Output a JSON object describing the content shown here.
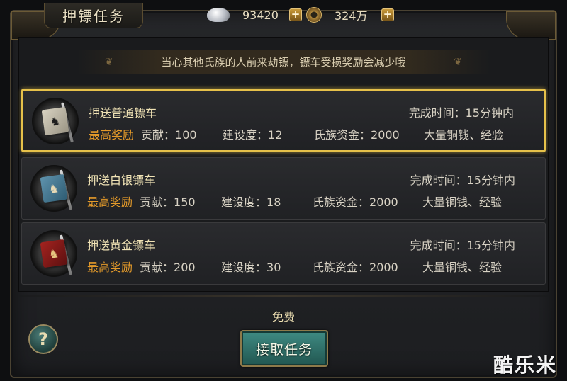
{
  "window": {
    "title": "押镖任务"
  },
  "currency": {
    "silver_value": "93420",
    "silver_icon": "silver-ingot-icon",
    "gold_value": "324万",
    "gold_icon": "copper-coin-icon",
    "add_label": "+"
  },
  "notice": "当心其他氏族的人前来劫镖，镖车受损奖励会减少哦",
  "tasks": [
    {
      "title": "押送普通镖车",
      "time": "完成时间：15分钟内",
      "reward_head": "最高奖励",
      "contribution": "贡献：100",
      "construction": "建设度：12",
      "clan_funds": "氏族资金：2000",
      "extra": "大量铜钱、经验",
      "flag_glyph": "♞",
      "selected": true
    },
    {
      "title": "押送白银镖车",
      "time": "完成时间：15分钟内",
      "reward_head": "最高奖励",
      "contribution": "贡献：150",
      "construction": "建设度：18",
      "clan_funds": "氏族资金：2000",
      "extra": "大量铜钱、经验",
      "flag_glyph": "♞",
      "selected": false
    },
    {
      "title": "押送黄金镖车",
      "time": "完成时间：15分钟内",
      "reward_head": "最高奖励",
      "contribution": "贡献：200",
      "construction": "建设度：30",
      "clan_funds": "氏族资金：2000",
      "extra": "大量铜钱、经验",
      "flag_glyph": "♞",
      "selected": false
    }
  ],
  "footer": {
    "cost": "免费",
    "accept_button": "接取任务",
    "help_glyph": "?"
  },
  "watermark": "酷乐米",
  "colors": {
    "accent_gold": "#e6c14a",
    "reward_orange": "#e49a2a",
    "button_teal": "#2f6f68"
  }
}
